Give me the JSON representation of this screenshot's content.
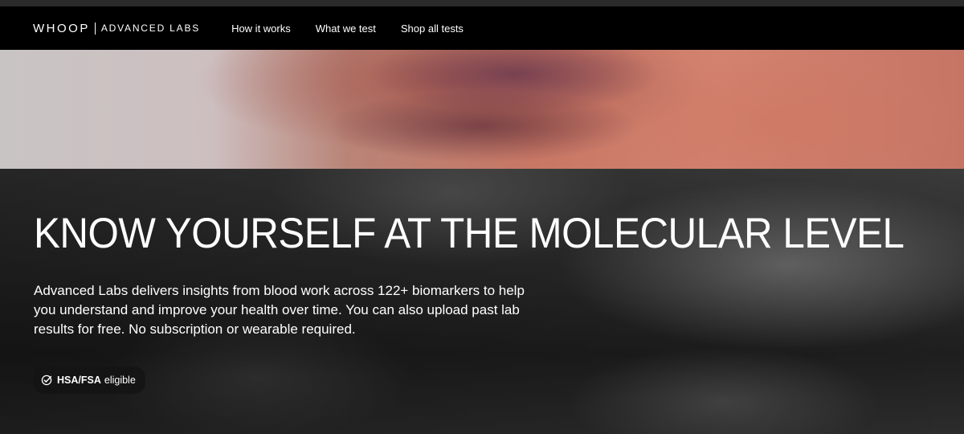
{
  "header": {
    "brand": {
      "logo": "WHOOP",
      "subtitle": "ADVANCED LABS"
    },
    "nav": [
      {
        "label": "How it works"
      },
      {
        "label": "What we test"
      },
      {
        "label": "Shop all tests"
      }
    ]
  },
  "hero": {
    "title": "KNOW YOURSELF AT THE MOLECULAR LEVEL",
    "description": "Advanced Labs delivers insights from blood work across 122+ biomarkers to help you understand and improve your health over time. You can also upload past lab results for free. No subscription or wearable required.",
    "badge": {
      "icon": "check-circle-icon",
      "strong": "HSA/FSA",
      "text": "eligible"
    }
  },
  "colors": {
    "nav_background": "#000000",
    "text": "#ffffff"
  }
}
